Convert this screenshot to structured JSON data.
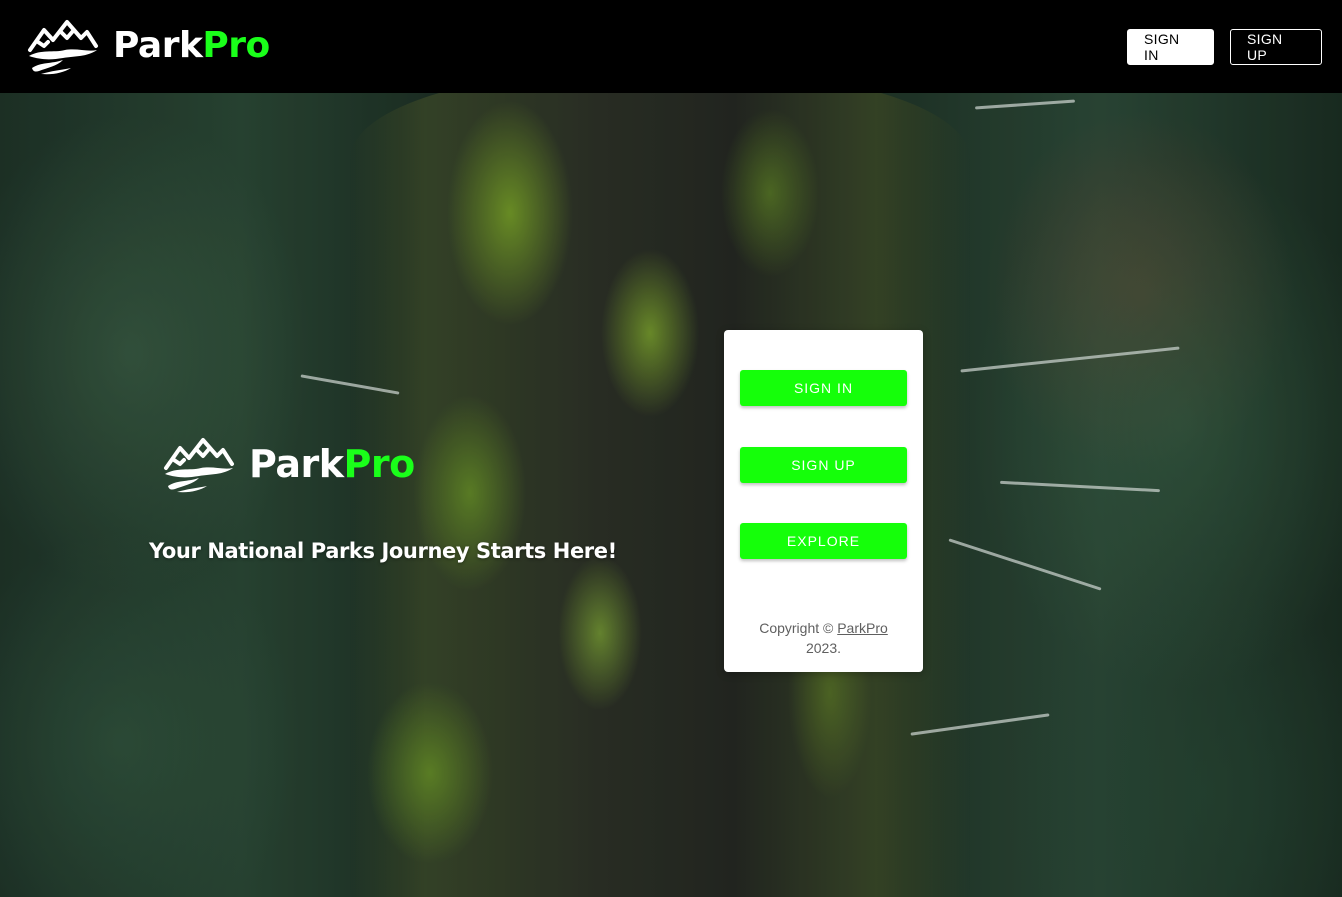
{
  "header": {
    "brand_part1": "Park",
    "brand_part2": "Pro",
    "sign_in_label": "SIGN IN",
    "sign_up_label": "SIGN UP",
    "logo_icon": "mountain-logo-icon"
  },
  "hero": {
    "brand_part1": "Park",
    "brand_part2": "Pro",
    "tagline": "Your National Parks Journey Starts Here!",
    "logo_icon": "mountain-logo-icon"
  },
  "card": {
    "sign_in_label": "SIGN IN",
    "sign_up_label": "SIGN UP",
    "explore_label": "EXPLORE",
    "copyright_prefix": "Copyright ©",
    "copyright_link": "ParkPro",
    "copyright_suffix": "2023."
  },
  "colors": {
    "accent_green": "#15ff0a",
    "navbar_bg": "#000000",
    "card_bg": "#ffffff"
  }
}
